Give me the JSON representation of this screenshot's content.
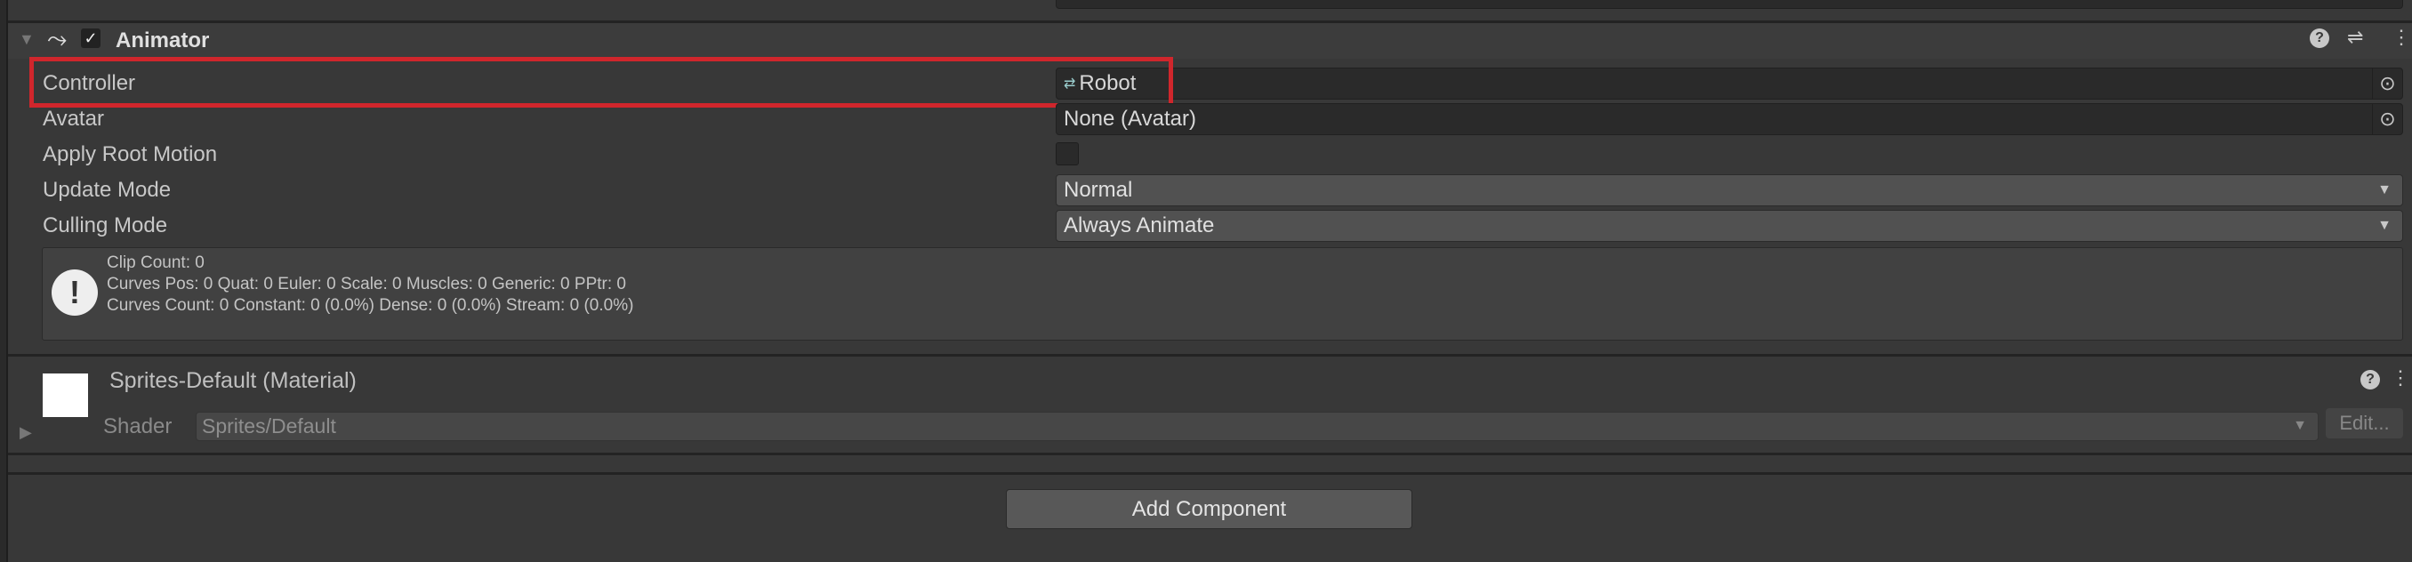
{
  "animator": {
    "title": "Animator",
    "enabled": true,
    "fields": {
      "controller": {
        "label": "Controller",
        "value": "Robot"
      },
      "avatar": {
        "label": "Avatar",
        "value": "None (Avatar)"
      },
      "apply_root_motion": {
        "label": "Apply Root Motion",
        "checked": false
      },
      "update_mode": {
        "label": "Update Mode",
        "value": "Normal"
      },
      "culling_mode": {
        "label": "Culling Mode",
        "value": "Always Animate"
      }
    },
    "info": {
      "line1": "Clip Count: 0",
      "line2": "Curves Pos: 0 Quat: 0 Euler: 0 Scale: 0 Muscles: 0 Generic: 0 PPtr: 0",
      "line3": "Curves Count: 0 Constant: 0 (0.0%) Dense: 0 (0.0%) Stream: 0 (0.0%)"
    },
    "highlight_color": "#d0262c"
  },
  "material": {
    "title": "Sprites-Default (Material)",
    "shader_label": "Shader",
    "shader_value": "Sprites/Default",
    "edit_label": "Edit..."
  },
  "add_component_label": "Add Component"
}
